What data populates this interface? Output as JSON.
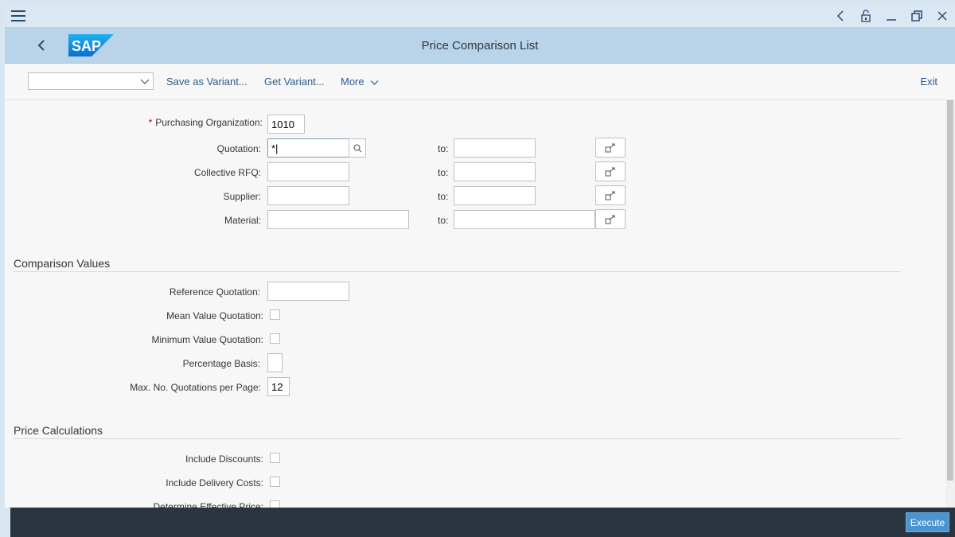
{
  "window": {
    "app_title": "Price Comparison List"
  },
  "toolbar": {
    "variant_value": "",
    "save_variant": "Save as Variant...",
    "get_variant": "Get Variant...",
    "more": "More",
    "exit": "Exit"
  },
  "selection": {
    "purch_org": {
      "label": "Purchasing Organization:",
      "value": "1010"
    },
    "quotation": {
      "label": "Quotation:",
      "from": "*|",
      "to": ""
    },
    "collective_rfq": {
      "label": "Collective RFQ:",
      "from": "",
      "to": ""
    },
    "supplier": {
      "label": "Supplier:",
      "from": "",
      "to": ""
    },
    "material": {
      "label": "Material:",
      "from": "",
      "to": ""
    },
    "to_label": "to:"
  },
  "comparison": {
    "title": "Comparison Values",
    "reference_quotation": {
      "label": "Reference Quotation:",
      "value": ""
    },
    "mean_value": {
      "label": "Mean Value Quotation:"
    },
    "minimum_value": {
      "label": "Minimum Value Quotation:"
    },
    "percentage_basis": {
      "label": "Percentage Basis:",
      "value": ""
    },
    "max_quotations": {
      "label": "Max. No. Quotations per Page:",
      "value": "12"
    }
  },
  "price_calc": {
    "title": "Price Calculations",
    "include_discounts": {
      "label": "Include Discounts:"
    },
    "include_delivery": {
      "label": "Include Delivery Costs:"
    },
    "effective_price": {
      "label": "Determine Effective Price:"
    }
  },
  "footer": {
    "execute": "Execute"
  },
  "colors": {
    "shell_bg": "#b9d3e8",
    "footer_bg": "#2a3540",
    "execute_bg": "#4a95cf",
    "required": "#bb0000",
    "link": "#2b5b8a"
  }
}
